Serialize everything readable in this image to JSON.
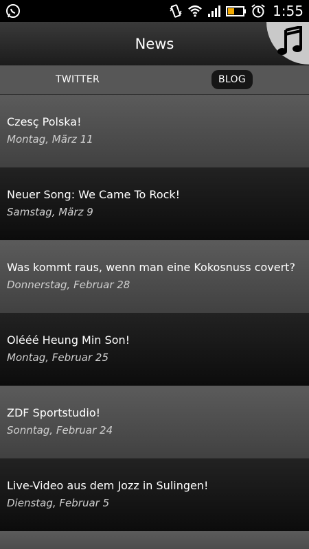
{
  "status_bar": {
    "time": "1:55",
    "icons": [
      "whatsapp-icon",
      "vibrate-icon",
      "wifi-icon",
      "signal-icon",
      "battery-icon",
      "alarm-icon"
    ]
  },
  "header": {
    "title": "News",
    "music_icon": "music-note-icon"
  },
  "tabs": [
    {
      "label": "TWITTER",
      "selected": false
    },
    {
      "label": "BLOG",
      "selected": true
    }
  ],
  "posts": [
    {
      "title": "Czesç Polska!",
      "date": "Montag, März 11"
    },
    {
      "title": "Neuer Song: We Came To Rock!",
      "date": "Samstag, März 9"
    },
    {
      "title": "Was kommt raus, wenn man eine Kokosnuss covert?",
      "date": "Donnerstag, Februar 28"
    },
    {
      "title": "Olééé Heung Min Son!",
      "date": "Montag, Februar 25"
    },
    {
      "title": "ZDF Sportstudio!",
      "date": "Sonntag, Februar 24"
    },
    {
      "title": "Live-Video aus dem Jozz in Sulingen!",
      "date": "Dienstag, Februar 5"
    }
  ]
}
